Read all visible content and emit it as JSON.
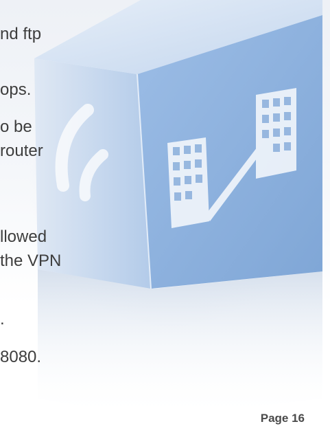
{
  "body_lines": [
    "nd ftp",
    "ops.",
    "o be",
    "router",
    "llowed",
    "the VPN",
    ".",
    "8080."
  ],
  "footer": {
    "page_label": "Page 16"
  },
  "colors": {
    "text": "#3d3d3d",
    "cube_front": "#8fb2dd",
    "cube_top": "#c6d9ef",
    "cube_left": "#a9c4e6"
  },
  "icons": [
    "wifi-signal-icon",
    "buildings-link-icon"
  ]
}
